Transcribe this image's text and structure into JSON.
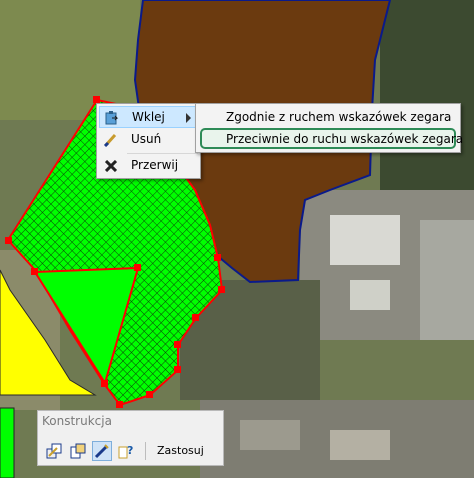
{
  "context_menu": {
    "items": [
      {
        "label": "Wklej",
        "icon": "paste-icon",
        "has_submenu": true
      },
      {
        "label": "Usuń",
        "icon": "delete-icon"
      },
      {
        "label": "Przerwij",
        "icon": "cancel-icon"
      }
    ]
  },
  "submenu": {
    "items": [
      {
        "label": "Zgodnie z ruchem wskazówek zegara"
      },
      {
        "label": "Przeciwnie do ruchu wskazówek zegara"
      }
    ]
  },
  "panel": {
    "title": "Konstrukcja",
    "apply_label": "Zastosuj",
    "tools": [
      "snap-tool-icon",
      "copy-tool-icon",
      "edit-tool-icon",
      "help-tool-icon"
    ]
  },
  "colors": {
    "selected_polygon": "#00ff00",
    "selected_outline": "#ff0000",
    "brown_parcel": "#6b3a0f",
    "yellow_parcel": "#ffff00"
  }
}
